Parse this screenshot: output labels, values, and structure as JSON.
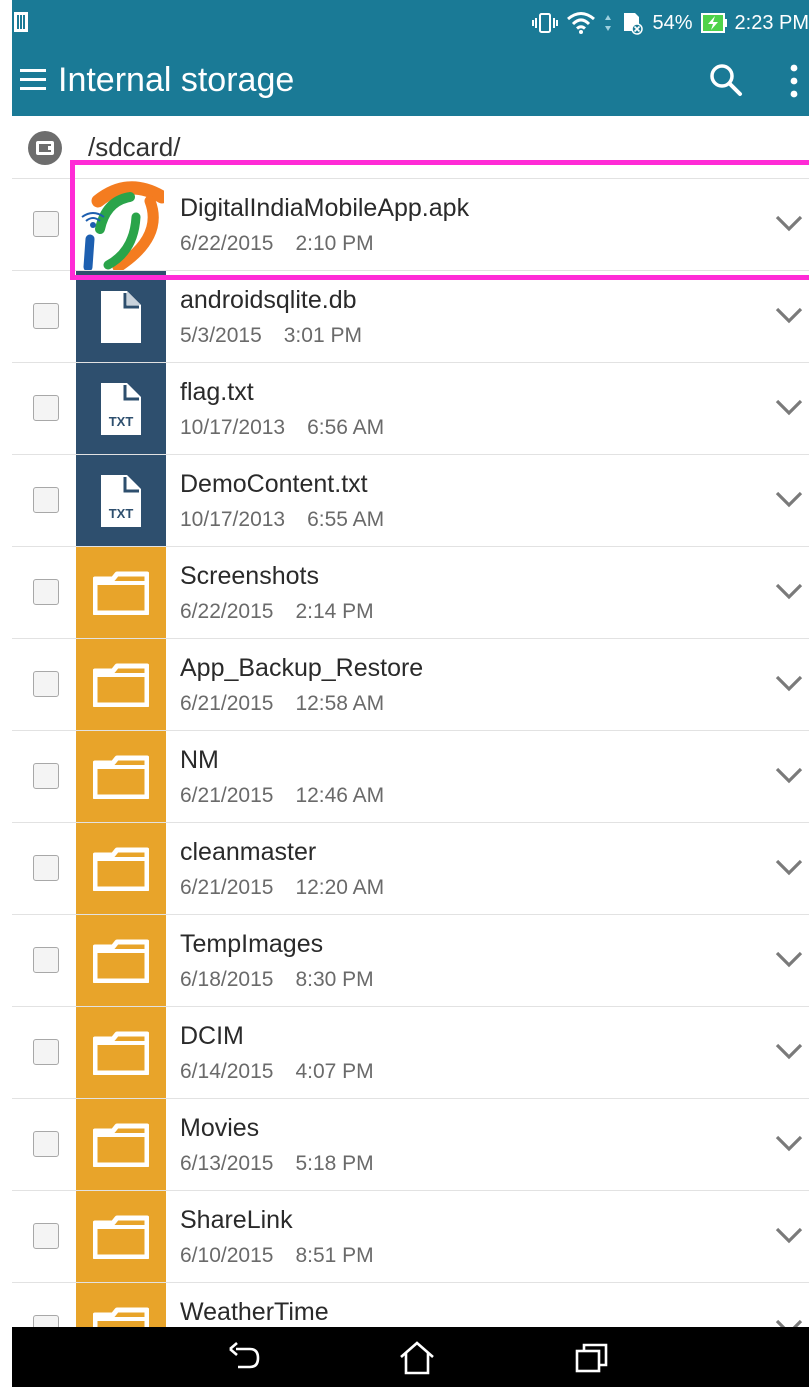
{
  "status_bar": {
    "battery_percent": "54%",
    "time": "2:23 PM"
  },
  "app_bar": {
    "title": "Internal storage"
  },
  "path": "/sdcard/",
  "files": [
    {
      "name": "DigitalIndiaMobileApp.apk",
      "date": "6/22/2015",
      "time": "2:10 PM",
      "icon": "app-icon"
    },
    {
      "name": "androidsqlite.db",
      "date": "5/3/2015",
      "time": "3:01 PM",
      "icon": "file-icon"
    },
    {
      "name": "flag.txt",
      "date": "10/17/2013",
      "time": "6:56 AM",
      "icon": "txt-file-icon",
      "badge": "TXT"
    },
    {
      "name": "DemoContent.txt",
      "date": "10/17/2013",
      "time": "6:55 AM",
      "icon": "txt-file-icon",
      "badge": "TXT"
    },
    {
      "name": "Screenshots",
      "date": "6/22/2015",
      "time": "2:14 PM",
      "icon": "folder-icon"
    },
    {
      "name": "App_Backup_Restore",
      "date": "6/21/2015",
      "time": "12:58 AM",
      "icon": "folder-icon"
    },
    {
      "name": "NM",
      "date": "6/21/2015",
      "time": "12:46 AM",
      "icon": "folder-icon"
    },
    {
      "name": "cleanmaster",
      "date": "6/21/2015",
      "time": "12:20 AM",
      "icon": "folder-icon"
    },
    {
      "name": "TempImages",
      "date": "6/18/2015",
      "time": "8:30 PM",
      "icon": "folder-icon"
    },
    {
      "name": "DCIM",
      "date": "6/14/2015",
      "time": "4:07 PM",
      "icon": "folder-icon"
    },
    {
      "name": "Movies",
      "date": "6/13/2015",
      "time": "5:18 PM",
      "icon": "folder-icon"
    },
    {
      "name": "ShareLink",
      "date": "6/10/2015",
      "time": "8:51 PM",
      "icon": "folder-icon"
    },
    {
      "name": "WeatherTime",
      "date": "",
      "time": "",
      "icon": "folder-icon"
    }
  ],
  "colors": {
    "app_bar": "#1a7a96",
    "doc_tile": "#2e4f6e",
    "folder_tile": "#e8a42a",
    "highlight": "#ff2bd6"
  }
}
